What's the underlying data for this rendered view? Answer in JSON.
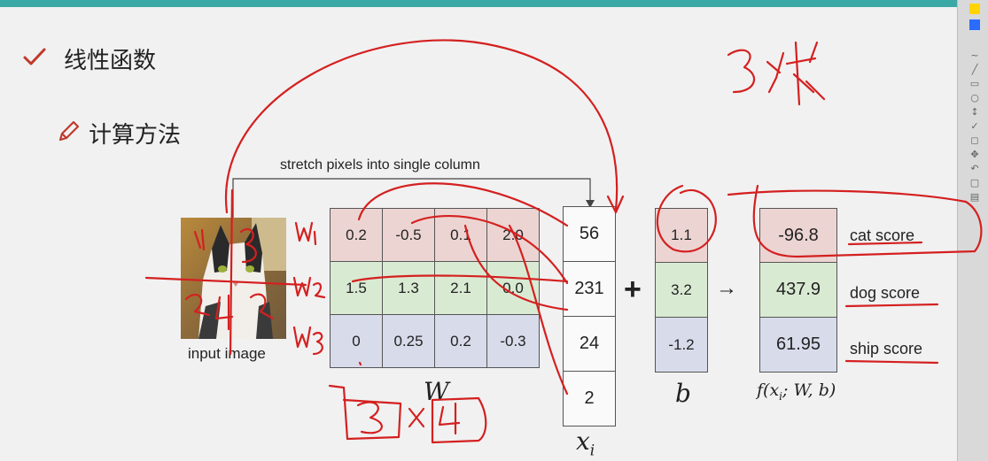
{
  "slide": {
    "heading1": "线性函数",
    "heading2": "计算方法",
    "stretch_label": "stretch pixels into single column",
    "input_image_label": "input image",
    "W_label": "W",
    "b_label": "b",
    "x_label": "x",
    "x_sub": "i",
    "f_label": "f(x",
    "f_sub": "i",
    "f_rest": "; W, b)",
    "plus": "+",
    "arrow": "→",
    "W": [
      [
        "0.2",
        "-0.5",
        "0.1",
        "2.0"
      ],
      [
        "1.5",
        "1.3",
        "2.1",
        "0.0"
      ],
      [
        "0",
        "0.25",
        "0.2",
        "-0.3"
      ]
    ],
    "x": [
      "56",
      "231",
      "24",
      "2"
    ],
    "b": [
      "1.1",
      "3.2",
      "-1.2"
    ],
    "scores": [
      "-96.8",
      "437.9",
      "61.95"
    ],
    "score_labels": [
      "cat score",
      "dog score",
      "ship score"
    ]
  },
  "annotations": {
    "row_labels": [
      "W1",
      "W2",
      "W3"
    ],
    "quadrant_numbers": [
      "1",
      "2",
      "3",
      "4"
    ],
    "dims": [
      "3",
      "×",
      "4"
    ],
    "top_right": "3 分类"
  },
  "colors": {
    "teal_bar": "#3aa9a6",
    "ink": "#d42020",
    "row_red": "#ecd4d2",
    "row_green": "#d9ead3",
    "row_blue": "#d7dbea"
  }
}
